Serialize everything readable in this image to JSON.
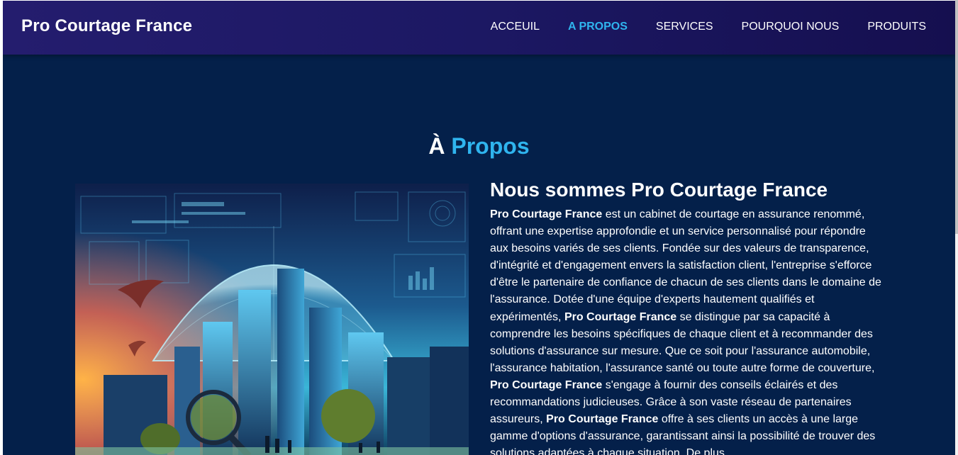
{
  "navbar": {
    "brand": "Pro Courtage France",
    "items": [
      {
        "label": "ACCEUIL",
        "active": false
      },
      {
        "label": "A PROPOS",
        "active": true
      },
      {
        "label": "SERVICES",
        "active": false
      },
      {
        "label": "POURQUOI NOUS",
        "active": false
      },
      {
        "label": "PRODUITS",
        "active": false
      }
    ]
  },
  "section": {
    "title_prefix": "À",
    "title_accent": "Propos"
  },
  "about": {
    "heading": "Nous sommes Pro Courtage France",
    "company_name": "Pro Courtage France",
    "text_1": " est un cabinet de courtage en assurance renommé, offrant une expertise approfondie et un service personnalisé pour répondre aux besoins variés de ses clients. Fondée sur des valeurs de transparence, d'intégrité et d'engagement envers la satisfaction client, l'entreprise s'efforce d'être le partenaire de confiance de chacun de ses clients dans le domaine de l'assurance. Dotée d'une équipe d'experts hautement qualifiés et expérimentés, ",
    "text_2": " se distingue par sa capacité à comprendre les besoins spécifiques de chaque client et à recommander des solutions d'assurance sur mesure. Que ce soit pour l'assurance automobile, l'assurance habitation, l'assurance santé ou toute autre forme de couverture, ",
    "text_3": " s'engage à fournir des conseils éclairés et des recommandations judicieuses. Grâce à son vaste réseau de partenaires assureurs, ",
    "text_4": " offre à ses clients un accès à une large gamme d'options d'assurance, garantissant ainsi la possibilité de trouver des solutions adaptées à chaque situation. De plus,"
  },
  "colors": {
    "accent": "#2fb4ee",
    "background": "#04204a",
    "navbar": "#1c1863"
  }
}
